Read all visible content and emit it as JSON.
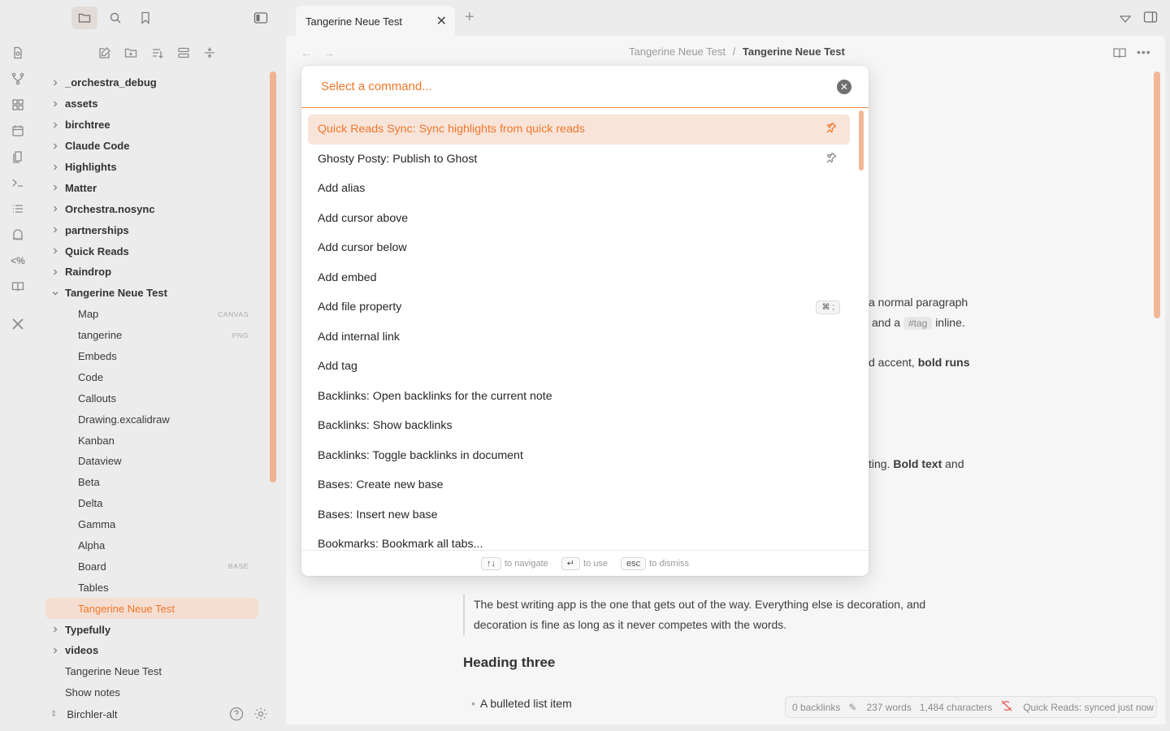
{
  "tabs": [
    {
      "label": "Tangerine Neue Test"
    }
  ],
  "breadcrumb": {
    "parent": "Tangerine Neue Test",
    "separator": "/",
    "current": "Tangerine Neue Test"
  },
  "tree": {
    "folders_top": [
      "_orchestra_debug",
      "assets",
      "birchtree",
      "Claude Code",
      "Highlights",
      "Matter",
      "Orchestra.nosync",
      "partnerships",
      "Quick Reads",
      "Raindrop"
    ],
    "open_folder": "Tangerine Neue Test",
    "children": [
      {
        "label": "Map",
        "tag": "CANVAS"
      },
      {
        "label": "tangerine",
        "tag": "PNG"
      },
      {
        "label": "Embeds",
        "tag": ""
      },
      {
        "label": "Code",
        "tag": ""
      },
      {
        "label": "Callouts",
        "tag": ""
      },
      {
        "label": "Drawing.excalidraw",
        "tag": ""
      },
      {
        "label": "Kanban",
        "tag": ""
      },
      {
        "label": "Dataview",
        "tag": ""
      },
      {
        "label": "Beta",
        "tag": ""
      },
      {
        "label": "Delta",
        "tag": ""
      },
      {
        "label": "Gamma",
        "tag": ""
      },
      {
        "label": "Alpha",
        "tag": ""
      },
      {
        "label": "Board",
        "tag": "BASE"
      },
      {
        "label": "Tables",
        "tag": ""
      },
      {
        "label": "Tangerine Neue Test",
        "tag": ""
      }
    ],
    "folders_bottom": [
      "Typefully",
      "videos"
    ],
    "files_bottom": [
      "Tangerine Neue Test",
      "Show notes"
    ],
    "vault_name": "Birchler-alt"
  },
  "palette": {
    "placeholder": "Select a command...",
    "commands": [
      {
        "label": "Quick Reads Sync: Sync highlights from quick reads",
        "pinned": true,
        "hotkey": ""
      },
      {
        "label": "Ghosty Posty: Publish to Ghost",
        "pinned": true,
        "hotkey": ""
      },
      {
        "label": "Add alias",
        "pinned": false,
        "hotkey": ""
      },
      {
        "label": "Add cursor above",
        "pinned": false,
        "hotkey": ""
      },
      {
        "label": "Add cursor below",
        "pinned": false,
        "hotkey": ""
      },
      {
        "label": "Add embed",
        "pinned": false,
        "hotkey": ""
      },
      {
        "label": "Add file property",
        "pinned": false,
        "hotkey": "⌘ ;"
      },
      {
        "label": "Add internal link",
        "pinned": false,
        "hotkey": ""
      },
      {
        "label": "Add tag",
        "pinned": false,
        "hotkey": ""
      },
      {
        "label": "Backlinks: Open backlinks for the current note",
        "pinned": false,
        "hotkey": ""
      },
      {
        "label": "Backlinks: Show backlinks",
        "pinned": false,
        "hotkey": ""
      },
      {
        "label": "Backlinks: Toggle backlinks in document",
        "pinned": false,
        "hotkey": ""
      },
      {
        "label": "Bases: Create new base",
        "pinned": false,
        "hotkey": ""
      },
      {
        "label": "Bases: Insert new base",
        "pinned": false,
        "hotkey": ""
      },
      {
        "label": "Bookmarks: Bookmark all tabs...",
        "pinned": false,
        "hotkey": ""
      }
    ],
    "footer": [
      {
        "key": "↑↓",
        "text": "to navigate"
      },
      {
        "key": "↵",
        "text": "to use"
      },
      {
        "key": "esc",
        "text": "to dismiss"
      }
    ]
  },
  "editor": {
    "frag1": "a normal paragraph",
    "frag2_pre": "and a",
    "frag2_tag": "#tag",
    "frag2_post": "inline.",
    "frag3_pre": "d accent,",
    "frag3_bold": "bold runs",
    "frag4_pre": "ting.",
    "frag4_bold": "Bold text",
    "frag4_post": "and",
    "quote": "The best writing app is the one that gets out of the way. Everything else is decoration, and decoration is fine as long as it never competes with the words.",
    "heading3": "Heading three",
    "bullet1": "A bulleted list item"
  },
  "status": {
    "backlinks": "0 backlinks",
    "words": "237 words",
    "chars": "1,484 characters",
    "sync": "Quick Reads: synced just now"
  },
  "colors": {
    "accent": "#f0772b",
    "selection": "#f8e4d9",
    "scrollbar": "#f2b797"
  }
}
